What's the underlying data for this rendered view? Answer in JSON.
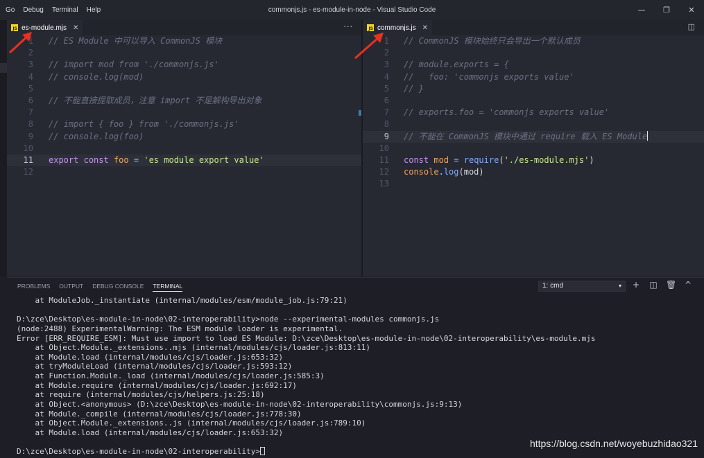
{
  "window": {
    "menu": [
      "Go",
      "Debug",
      "Terminal",
      "Help"
    ],
    "title": "commonjs.js - es-module-in-node - Visual Studio Code",
    "controls": [
      "—",
      "❐",
      "✕"
    ]
  },
  "left_editor": {
    "tab": {
      "icon": "JS",
      "label": "es-module.mjs",
      "close": "✕"
    },
    "tab_actions": "···",
    "lines": [
      {
        "n": "1",
        "text": "// ES Module 中可以导入 CommonJS 模块"
      },
      {
        "n": "2",
        "text": ""
      },
      {
        "n": "3",
        "text": "// import mod from './commonjs.js'"
      },
      {
        "n": "4",
        "text": "// console.log(mod)"
      },
      {
        "n": "5",
        "text": ""
      },
      {
        "n": "6",
        "text": "// 不能直接提取成员，注意 import 不是解构导出对象"
      },
      {
        "n": "7",
        "text": ""
      },
      {
        "n": "8",
        "text": "// import { foo } from './commonjs.js'"
      },
      {
        "n": "9",
        "text": "// console.log(foo)"
      },
      {
        "n": "10",
        "text": ""
      },
      {
        "n": "11",
        "kw": "export",
        "kw2": "const",
        "var": "foo",
        "op": "=",
        "str": "'es module export value'"
      },
      {
        "n": "12",
        "text": ""
      }
    ]
  },
  "right_editor": {
    "tab": {
      "icon": "JS",
      "label": "commonjs.js",
      "close": "✕"
    },
    "tab_actions": "◫",
    "lines": [
      {
        "n": "1",
        "text": "// CommonJS 模块始终只会导出一个默认成员"
      },
      {
        "n": "2",
        "text": ""
      },
      {
        "n": "3",
        "text": "// module.exports = {"
      },
      {
        "n": "4",
        "text": "//   foo: 'commonjs exports value'"
      },
      {
        "n": "5",
        "text": "// }"
      },
      {
        "n": "6",
        "text": ""
      },
      {
        "n": "7",
        "text": "// exports.foo = 'commonjs exports value'"
      },
      {
        "n": "8",
        "text": ""
      },
      {
        "n": "9",
        "text": "// 不能在 CommonJS 模块中通过 require 载入 ES Module"
      },
      {
        "n": "10",
        "text": ""
      },
      {
        "n": "11",
        "kw": "const",
        "var": "mod",
        "op": "=",
        "fn": "require",
        "p1": "(",
        "str": "'./es-module.mjs'",
        "p2": ")"
      },
      {
        "n": "12",
        "obj": "console",
        "dot": ".",
        "fn": "log",
        "p1": "(",
        "var": "mod",
        "p2": ")"
      },
      {
        "n": "13",
        "text": ""
      }
    ]
  },
  "panel": {
    "tabs": [
      "PROBLEMS",
      "OUTPUT",
      "DEBUG CONSOLE",
      "TERMINAL"
    ],
    "terminal_select": "1: cmd",
    "terminal_caret": "▾",
    "icons": [
      "+",
      "◫",
      "🗑",
      "^"
    ]
  },
  "terminal": {
    "lines": [
      "    at ModuleJob._instantiate (internal/modules/esm/module_job.js:79:21)",
      "",
      "D:\\zce\\Desktop\\es-module-in-node\\02-interoperability>node --experimental-modules commonjs.js",
      "(node:2488) ExperimentalWarning: The ESM module loader is experimental.",
      "Error [ERR_REQUIRE_ESM]: Must use import to load ES Module: D:\\zce\\Desktop\\es-module-in-node\\02-interoperability\\es-module.mjs",
      "    at Object.Module._extensions..mjs (internal/modules/cjs/loader.js:813:11)",
      "    at Module.load (internal/modules/cjs/loader.js:653:32)",
      "    at tryModuleLoad (internal/modules/cjs/loader.js:593:12)",
      "    at Function.Module._load (internal/modules/cjs/loader.js:585:3)",
      "    at Module.require (internal/modules/cjs/loader.js:692:17)",
      "    at require (internal/modules/cjs/helpers.js:25:18)",
      "    at Object.<anonymous> (D:\\zce\\Desktop\\es-module-in-node\\02-interoperability\\commonjs.js:9:13)",
      "    at Module._compile (internal/modules/cjs/loader.js:778:30)",
      "    at Object.Module._extensions..js (internal/modules/cjs/loader.js:789:10)",
      "    at Module.load (internal/modules/cjs/loader.js:653:32)",
      ""
    ],
    "prompt": "D:\\zce\\Desktop\\es-module-in-node\\02-interoperability>"
  },
  "watermark": "https://blog.csdn.net/woyebuzhidao321",
  "colors": {
    "arrow": "#e8311f",
    "accent": "#3c7da8"
  }
}
